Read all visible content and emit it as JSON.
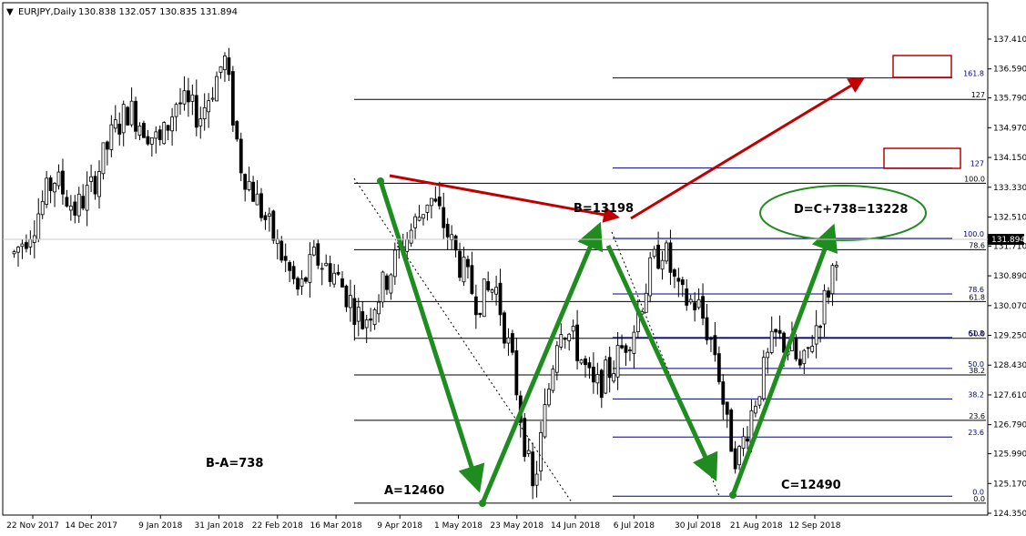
{
  "header": {
    "menu_glyph": "▼",
    "symbol": "EURJPY,Daily",
    "ohlc": "130.838 132.057 130.835 131.894"
  },
  "colors": {
    "background": "#ffffff",
    "candle": "#000000",
    "fib_black": "#000000",
    "fib_blue": "#000080",
    "arrow_green": "#1e8c1e",
    "arrow_red": "#c00000",
    "box_red": "#c00000",
    "ellipse_green": "#1e8c1e",
    "price_marker": "#000000"
  },
  "chart_data": {
    "type": "candlestick",
    "title": "EURJPY,Daily",
    "xlabel": "",
    "ylabel": "",
    "ylim": [
      124.4,
      137.8
    ],
    "y_ticks": [
      "137.410",
      "136.590",
      "135.790",
      "134.970",
      "134.150",
      "133.330",
      "132.510",
      "131.710",
      "130.890",
      "130.070",
      "129.250",
      "128.430",
      "127.610",
      "126.790",
      "125.990",
      "125.170",
      "124.350"
    ],
    "x_ticks": [
      "22 Nov 2017",
      "14 Dec 2017",
      "9 Jan 2018",
      "31 Jan 2018",
      "22 Feb 2018",
      "16 Mar 2018",
      "9 Apr 2018",
      "1 May 2018",
      "23 May 2018",
      "14 Jun 2018",
      "6 Jul 2018",
      "30 Jul 2018",
      "21 Aug 2018",
      "12 Sep 2018"
    ],
    "current_price": "131.894",
    "price_path": [
      {
        "date": "2017-11-15",
        "close": 131.5
      },
      {
        "date": "2017-11-22",
        "close": 132.3
      },
      {
        "date": "2017-11-30",
        "close": 133.6
      },
      {
        "date": "2017-12-08",
        "close": 132.7
      },
      {
        "date": "2017-12-14",
        "close": 133.3
      },
      {
        "date": "2017-12-22",
        "close": 134.8
      },
      {
        "date": "2017-12-28",
        "close": 135.5
      },
      {
        "date": "2018-01-09",
        "close": 134.5
      },
      {
        "date": "2018-01-15",
        "close": 135.7
      },
      {
        "date": "2018-01-24",
        "close": 135.3
      },
      {
        "date": "2018-01-31",
        "close": 136.5
      },
      {
        "date": "2018-02-02",
        "close": 136.9
      },
      {
        "date": "2018-02-08",
        "close": 134.0
      },
      {
        "date": "2018-02-14",
        "close": 133.0
      },
      {
        "date": "2018-02-22",
        "close": 131.7
      },
      {
        "date": "2018-03-02",
        "close": 130.4
      },
      {
        "date": "2018-03-08",
        "close": 131.4
      },
      {
        "date": "2018-03-16",
        "close": 130.9
      },
      {
        "date": "2018-03-26",
        "close": 129.6
      },
      {
        "date": "2018-04-02",
        "close": 130.5
      },
      {
        "date": "2018-04-09",
        "close": 131.6
      },
      {
        "date": "2018-04-16",
        "close": 132.5
      },
      {
        "date": "2018-04-20",
        "close": 133.1
      },
      {
        "date": "2018-04-25",
        "close": 132.4
      },
      {
        "date": "2018-05-01",
        "close": 131.3
      },
      {
        "date": "2018-05-08",
        "close": 130.2
      },
      {
        "date": "2018-05-15",
        "close": 130.6
      },
      {
        "date": "2018-05-22",
        "close": 128.2
      },
      {
        "date": "2018-05-29",
        "close": 124.9
      },
      {
        "date": "2018-06-04",
        "close": 127.8
      },
      {
        "date": "2018-06-08",
        "close": 129.7
      },
      {
        "date": "2018-06-14",
        "close": 129.0
      },
      {
        "date": "2018-06-21",
        "close": 127.7
      },
      {
        "date": "2018-06-28",
        "close": 128.4
      },
      {
        "date": "2018-07-06",
        "close": 129.5
      },
      {
        "date": "2018-07-13",
        "close": 131.2
      },
      {
        "date": "2018-07-17",
        "close": 131.7
      },
      {
        "date": "2018-07-23",
        "close": 130.3
      },
      {
        "date": "2018-07-30",
        "close": 130.1
      },
      {
        "date": "2018-08-06",
        "close": 128.7
      },
      {
        "date": "2018-08-10",
        "close": 126.7
      },
      {
        "date": "2018-08-14",
        "close": 125.8
      },
      {
        "date": "2018-08-21",
        "close": 127.6
      },
      {
        "date": "2018-08-28",
        "close": 129.2
      },
      {
        "date": "2018-09-03",
        "close": 128.9
      },
      {
        "date": "2018-09-07",
        "close": 128.2
      },
      {
        "date": "2018-09-12",
        "close": 129.4
      },
      {
        "date": "2018-09-17",
        "close": 130.5
      },
      {
        "date": "2018-09-21",
        "close": 131.9
      }
    ],
    "fib_levels": [
      {
        "label": "127",
        "price": 135.75,
        "color": "#000000"
      },
      {
        "label": "100.0",
        "price": 133.44,
        "color": "#000000"
      },
      {
        "label": "78.6",
        "price": 131.61,
        "color": "#000000"
      },
      {
        "label": "61.8",
        "price": 130.18,
        "color": "#000000"
      },
      {
        "label": "50.0",
        "price": 129.17,
        "color": "#000000"
      },
      {
        "label": "38.2",
        "price": 128.16,
        "color": "#000000"
      },
      {
        "label": "23.6",
        "price": 126.91,
        "color": "#000000"
      },
      {
        "label": "0.0",
        "price": 124.63,
        "color": "#000000"
      },
      {
        "label": "161.8",
        "price": 136.34,
        "color": "#000080"
      },
      {
        "label": "127",
        "price": 133.86,
        "color": "#000080"
      },
      {
        "label": "100.0",
        "price": 131.92,
        "color": "#000080"
      },
      {
        "label": "78.6",
        "price": 130.39,
        "color": "#000080"
      },
      {
        "label": "61.8",
        "price": 129.19,
        "color": "#000080"
      },
      {
        "label": "50.0",
        "price": 128.34,
        "color": "#000080"
      },
      {
        "label": "38.2",
        "price": 127.5,
        "color": "#000080"
      },
      {
        "label": "23.6",
        "price": 126.45,
        "color": "#000080"
      },
      {
        "label": "0.0",
        "price": 124.82,
        "color": "#000080"
      }
    ],
    "annotations": [
      {
        "text": "B=13198"
      },
      {
        "text": "D=C+738=13228"
      },
      {
        "text": "B-A=738"
      },
      {
        "text": "A=12460"
      },
      {
        "text": "C=12490"
      }
    ]
  }
}
